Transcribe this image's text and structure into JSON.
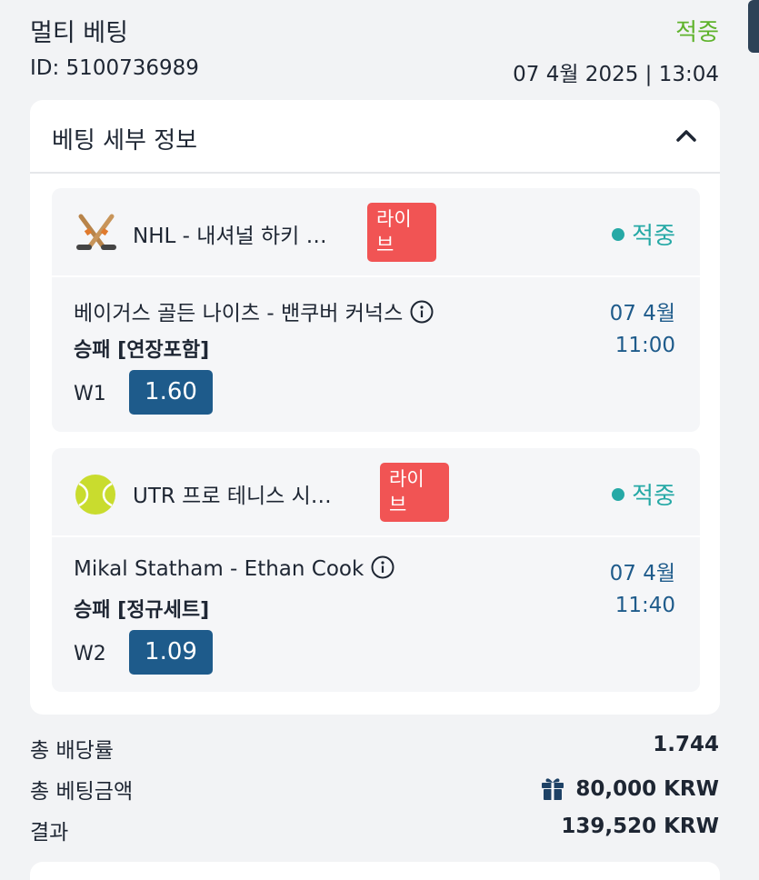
{
  "header": {
    "title": "멀티 베팅",
    "status": "적중",
    "id_text": "ID: 5100736989",
    "datetime": "07 4월 2025 | 13:04"
  },
  "details": {
    "title": "베팅 세부 정보",
    "collapse_icon": "chevron-up-icon"
  },
  "bets": [
    {
      "sport_icon": "hockey-sticks-icon",
      "league": "NHL - 내셔널 하키 …",
      "live": "라이\n브",
      "status": "적중",
      "match": "베이거스 골든 나이츠 - 밴쿠버 커넉스",
      "market": "승패 [연장포함]",
      "pick": "W1",
      "odds": "1.60",
      "date": "07 4월",
      "time": "11:00"
    },
    {
      "sport_icon": "tennis-ball-icon",
      "league": "UTR 프로 테니스 시…",
      "live": "라이\n브",
      "status": "적중",
      "match": "Mikal Statham - Ethan Cook",
      "market": "승패 [정규세트]",
      "pick": "W2",
      "odds": "1.09",
      "date": "07 4월",
      "time": "11:40"
    }
  ],
  "summary": {
    "total_odds_label": "총 배당률",
    "total_odds_value": "1.744",
    "stake_label": "총 베팅금액",
    "stake_value": "80,000 KRW",
    "result_label": "결과",
    "result_value": "139,520 KRW"
  },
  "colors": {
    "win_green": "#5fb32c",
    "status_teal": "#26a9a6",
    "live_red": "#f15454",
    "odds_blue": "#1e5b8b"
  }
}
